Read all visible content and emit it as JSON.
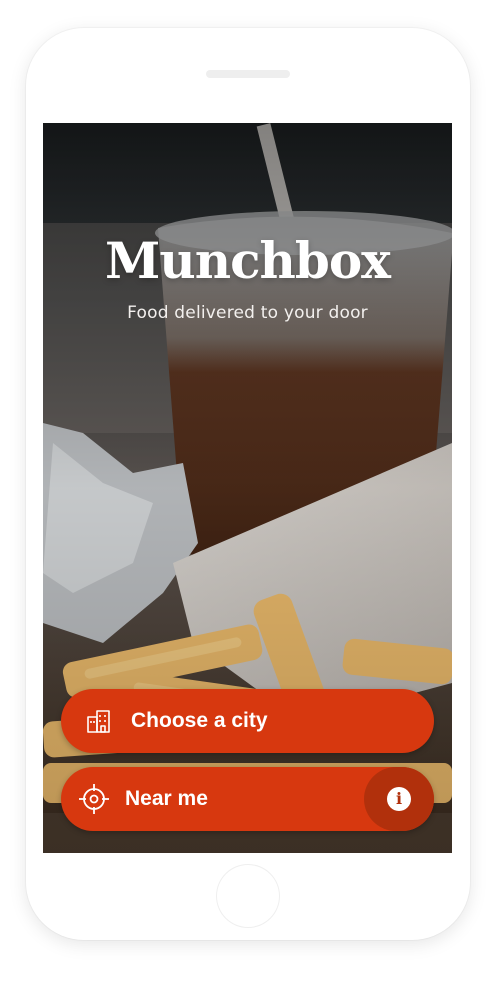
{
  "app": {
    "brand_title": "Munchbox",
    "tagline": "Food delivered to your door"
  },
  "actions": {
    "choose_city_label": "Choose a city",
    "near_me_label": "Near me",
    "info_glyph": "i"
  },
  "icons": {
    "choose_city": "city-buildings-icon",
    "near_me": "crosshair-target-icon",
    "info": "info-icon"
  },
  "colors": {
    "accent": "#d7380f",
    "accent_dark": "#b1300c",
    "text_on_accent": "#ffffff"
  }
}
